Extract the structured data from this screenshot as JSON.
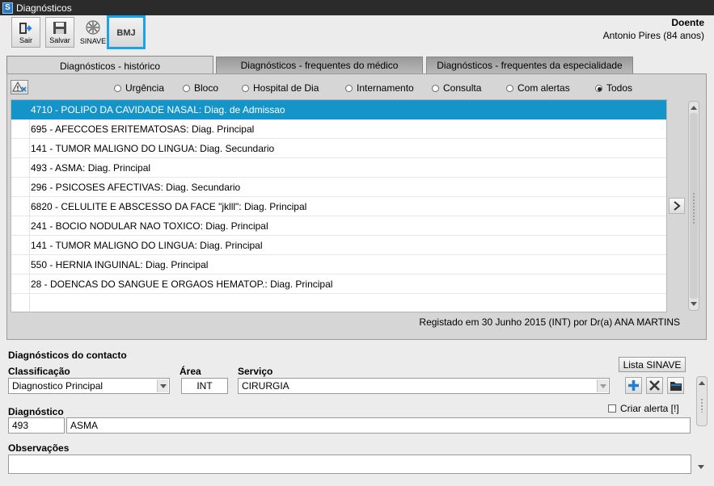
{
  "window": {
    "title": "Diagnósticos",
    "app_icon_letter": "S"
  },
  "toolbar": {
    "sair_label": "Sair",
    "salvar_label": "Salvar",
    "sinave_label": "SINAVE",
    "bmj_label": "BMJ"
  },
  "patient": {
    "label": "Doente",
    "name": "Antonio Pires (84 anos)"
  },
  "tabs": [
    {
      "label": "Diagnósticos - histórico",
      "active": true
    },
    {
      "label": "Diagnósticos - frequentes do médico",
      "active": false
    },
    {
      "label": "Diagnósticos -  frequentes da especialidade",
      "active": false
    }
  ],
  "filters": [
    {
      "label": "Urgência",
      "selected": false
    },
    {
      "label": "Bloco",
      "selected": false
    },
    {
      "label": "Hospital de Dia",
      "selected": false
    },
    {
      "label": "Internamento",
      "selected": false
    },
    {
      "label": "Consulta",
      "selected": false
    },
    {
      "label": "Com alertas",
      "selected": false
    },
    {
      "label": "Todos",
      "selected": true
    }
  ],
  "history": [
    "4710 - POLIPO DA CAVIDADE NASAL: Diag. de Admissao",
    "695 - AFECCOES ERITEMATOSAS: Diag. Principal",
    "141 - TUMOR MALIGNO DO LINGUA: Diag. Secundario",
    "493 - ASMA: Diag. Principal",
    "296 - PSICOSES AFECTIVAS: Diag. Secundario",
    "6820 - CELULITE E ABSCESSO DA FACE \"jklll\": Diag. Principal",
    "241 - BOCIO NODULAR NAO TOXICO: Diag. Principal",
    "141 - TUMOR MALIGNO DO LINGUA: Diag. Principal",
    "550 - HERNIA INGUINAL: Diag. Principal",
    "28 - DOENCAS DO SANGUE E ORGAOS HEMATOP.: Diag. Principal"
  ],
  "registado": "Registado em 30 Junho 2015 (INT) por Dr(a) ANA MARTINS",
  "contact": {
    "section_title": "Diagnósticos do contacto",
    "lista_sinave_label": "Lista SINAVE",
    "classificacao_label": "Classificação",
    "classificacao_value": "Diagnostico Principal",
    "area_label": "Área",
    "area_value": "INT",
    "servico_label": "Serviço",
    "servico_value": "CIRURGIA",
    "criar_alerta_label": "Criar alerta [!]",
    "diagnostico_label": "Diagnóstico",
    "diagnostico_code": "493",
    "diagnostico_desc": "ASMA",
    "observacoes_label": "Observações",
    "observacoes_value": ""
  }
}
